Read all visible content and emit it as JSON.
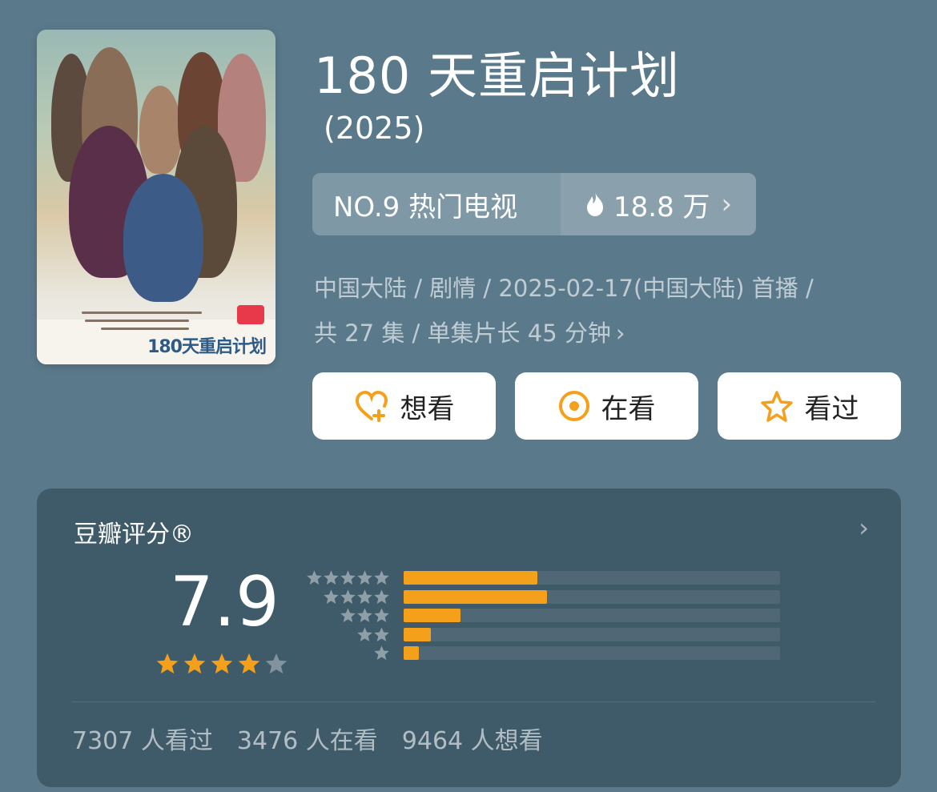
{
  "title": "180 天重启计划",
  "year": "(2025)",
  "rank": {
    "label": "NO.9 热门电视",
    "heat": "18.8 万",
    "heat_icon": "flame-icon"
  },
  "meta": {
    "line1": "中国大陆 / 剧情 / 2025-02-17(中国大陆) 首播 /",
    "line2": "共 27 集 / 单集片长 45 分钟"
  },
  "actions": [
    {
      "label": "想看",
      "icon": "heart-plus-icon"
    },
    {
      "label": "在看",
      "icon": "target-icon"
    },
    {
      "label": "看过",
      "icon": "star-outline-icon"
    }
  ],
  "rating": {
    "title": "豆瓣评分®",
    "score": "7.9",
    "stars": 4,
    "distribution": [
      {
        "stars": 5,
        "fraction": 0.355
      },
      {
        "stars": 4,
        "fraction": 0.38
      },
      {
        "stars": 3,
        "fraction": 0.152
      },
      {
        "stars": 2,
        "fraction": 0.072
      },
      {
        "stars": 1,
        "fraction": 0.04
      }
    ],
    "stats": [
      "7307 人看过",
      "3476 人在看",
      "9464 人想看"
    ]
  },
  "colors": {
    "background": "#5a7a8c",
    "panel": "#3f5a69",
    "accent": "#f5a01a",
    "button": "#ffffff"
  },
  "poster": {
    "logo_text": "180天重启计划"
  }
}
